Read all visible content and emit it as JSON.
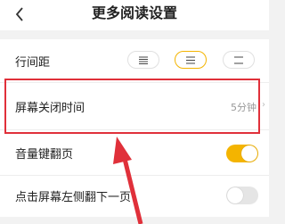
{
  "header": {
    "title": "更多阅读设置",
    "back_icon": "chevron-left-icon"
  },
  "line_spacing": {
    "label": "行间距",
    "options": [
      {
        "icon": "line-spacing-tight-icon",
        "glyph": "☰"
      },
      {
        "icon": "line-spacing-medium-icon",
        "glyph": "☰"
      },
      {
        "icon": "line-spacing-wide-icon",
        "glyph": "☰"
      }
    ],
    "selected_index": 1
  },
  "screen_off_time": {
    "label": "屏幕关闭时间",
    "value": "5分钟"
  },
  "volume_key_flip": {
    "label": "音量键翻页",
    "enabled": true
  },
  "tap_left_flip": {
    "label": "点击屏幕左侧翻下一页",
    "enabled": false
  },
  "colors": {
    "accent": "#f4b400",
    "highlight": "#e0303a",
    "toggle_off": "#e5e5e5"
  }
}
